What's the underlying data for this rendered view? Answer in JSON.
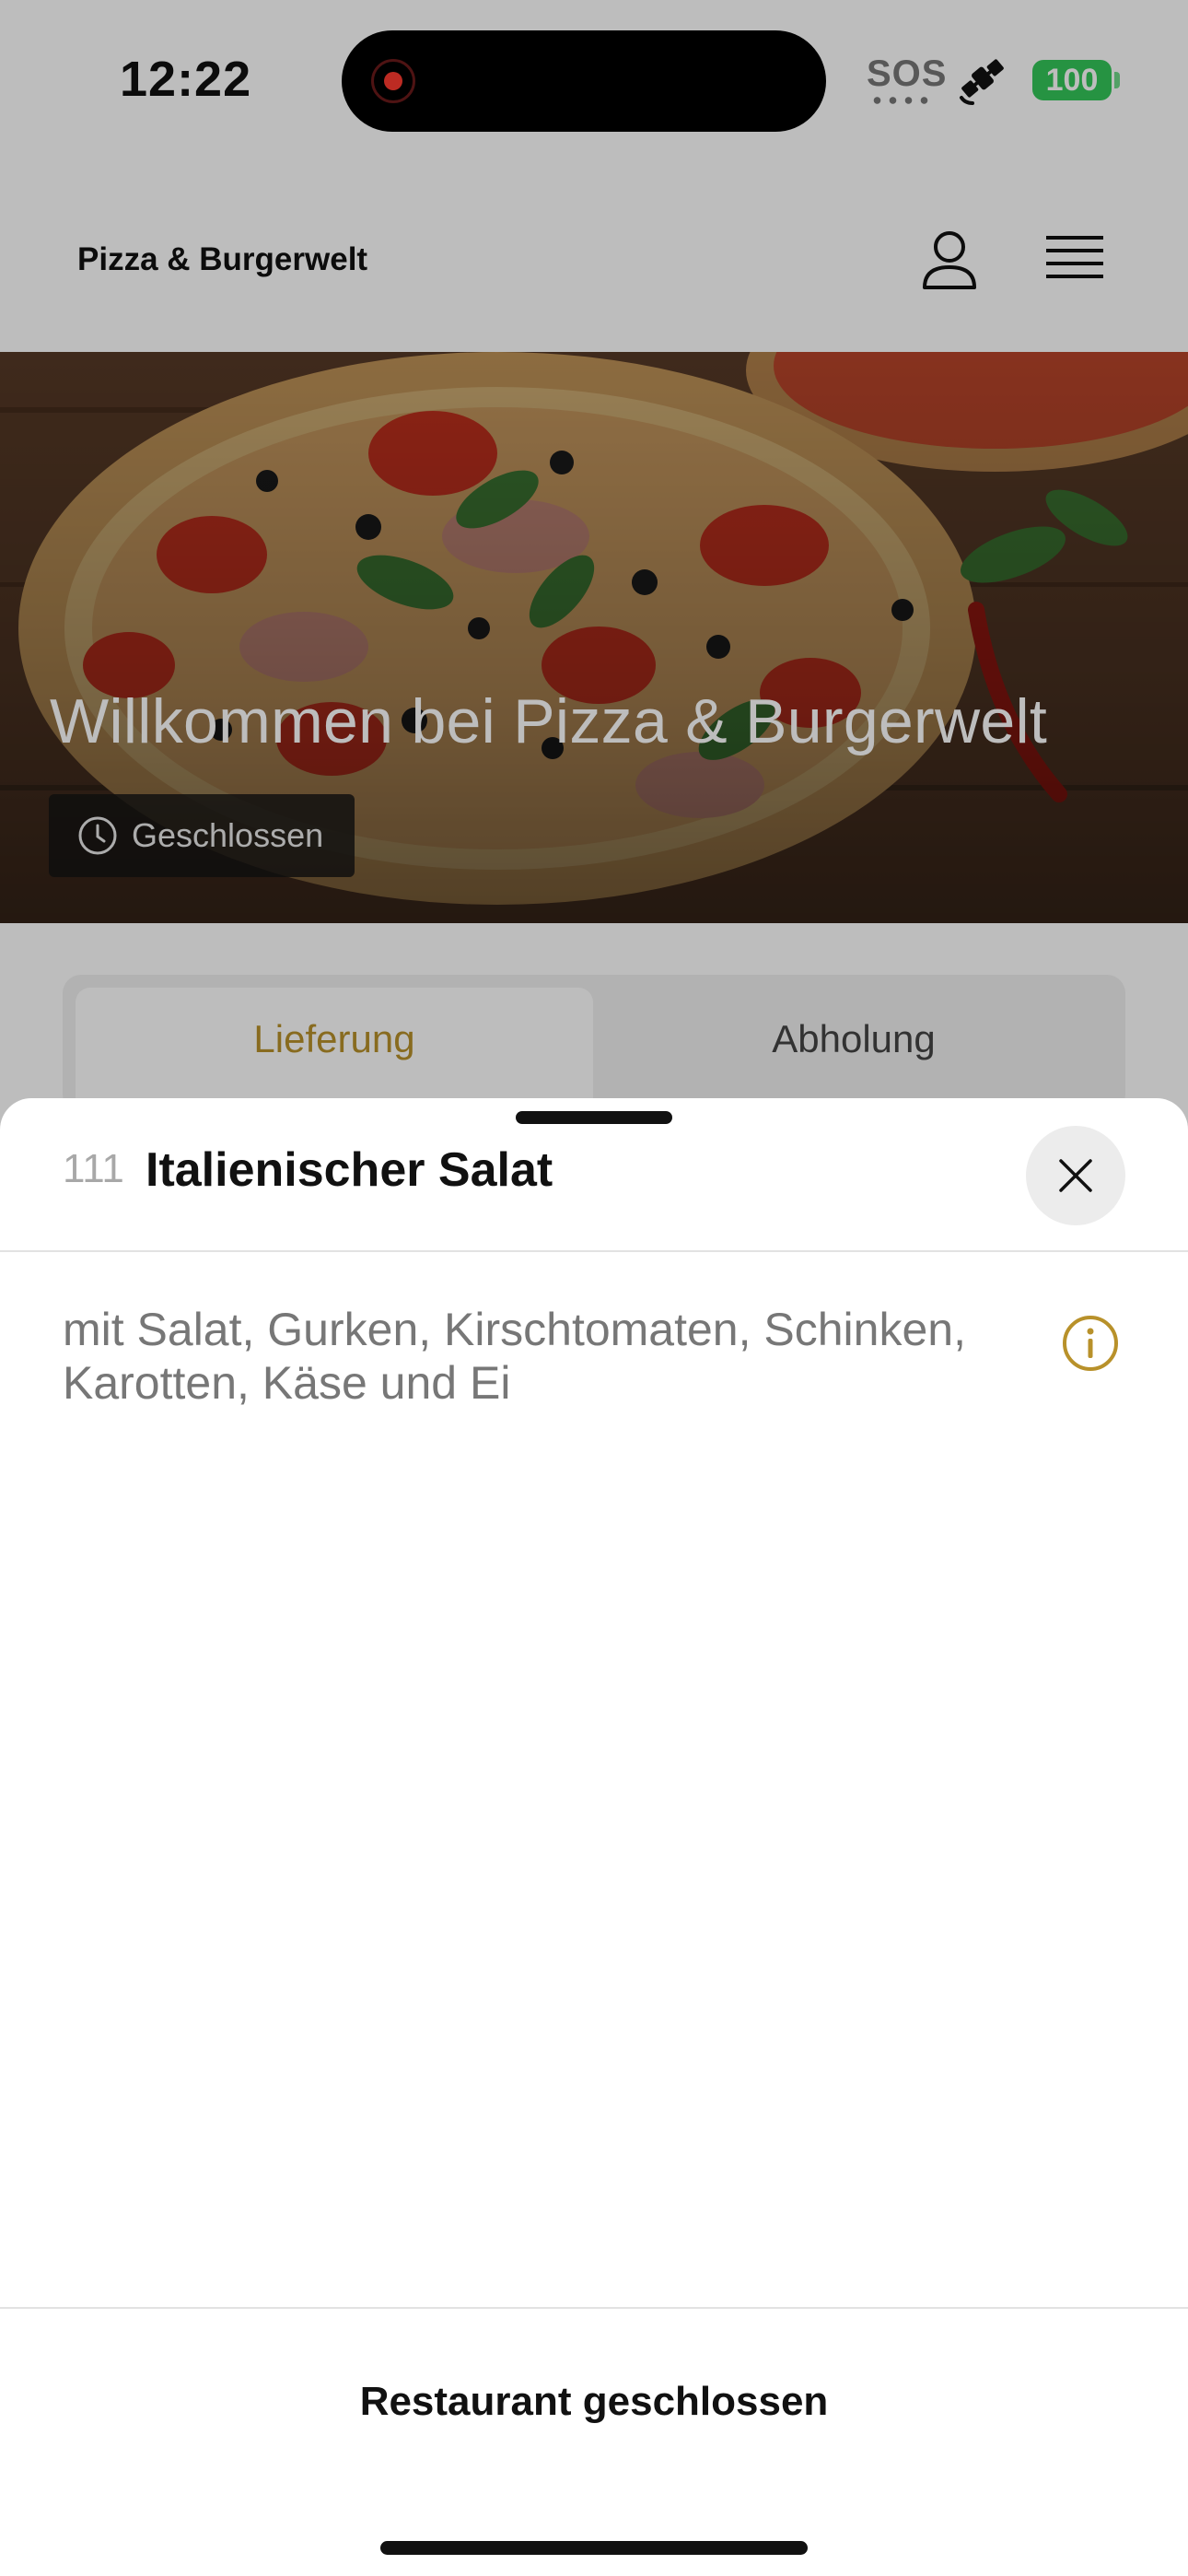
{
  "status_bar": {
    "time": "12:22",
    "sos": "SOS",
    "battery": "100",
    "recording_color": "#ff3b30",
    "battery_color": "#34c759"
  },
  "header": {
    "brand": "Pizza & Burgerwelt",
    "icons": [
      "user-icon",
      "hamburger-menu-icon"
    ]
  },
  "hero": {
    "title": "Willkommen bei Pizza & Burgerwelt",
    "status": "Geschlossen"
  },
  "tabs": [
    {
      "label": "Lieferung",
      "active": true
    },
    {
      "label": "Abholung",
      "active": false
    }
  ],
  "sheet": {
    "item_number": "111",
    "item_title": "Italienischer Salat",
    "description": "mit Salat, Gurken, Kirschtomaten, Schinken, Karotten, Käse und Ei",
    "footer_status": "Restaurant geschlossen"
  },
  "colors": {
    "accent": "#b8912a",
    "text": "#111111",
    "muted": "#777777"
  }
}
